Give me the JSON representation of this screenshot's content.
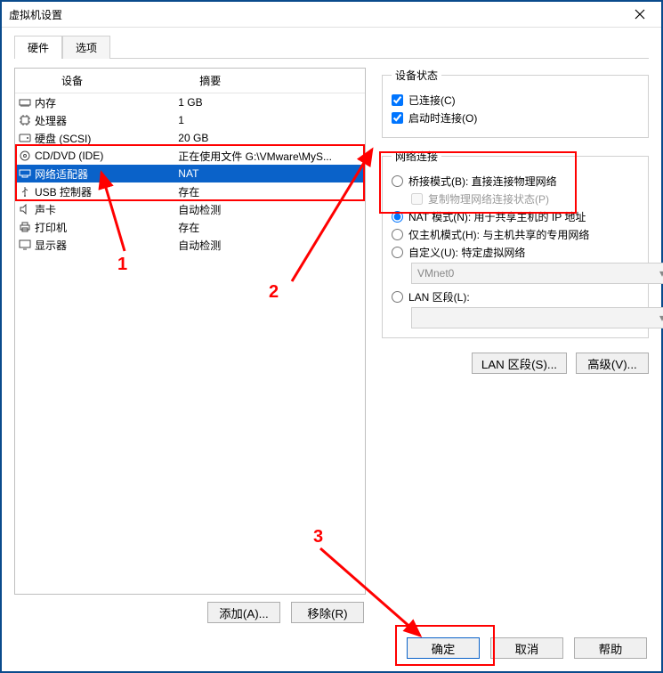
{
  "window": {
    "title": "虚拟机设置"
  },
  "tabs": {
    "hardware": "硬件",
    "options": "选项"
  },
  "deviceHeader": {
    "device": "设备",
    "summary": "摘要"
  },
  "devices": [
    {
      "name": "内存",
      "summary": "1 GB"
    },
    {
      "name": "处理器",
      "summary": "1"
    },
    {
      "name": "硬盘 (SCSI)",
      "summary": "20 GB"
    },
    {
      "name": "CD/DVD (IDE)",
      "summary": "正在使用文件 G:\\VMware\\MyS..."
    },
    {
      "name": "网络适配器",
      "summary": "NAT"
    },
    {
      "name": "USB 控制器",
      "summary": "存在"
    },
    {
      "name": "声卡",
      "summary": "自动检测"
    },
    {
      "name": "打印机",
      "summary": "存在"
    },
    {
      "name": "显示器",
      "summary": "自动检测"
    }
  ],
  "leftButtons": {
    "add": "添加(A)...",
    "remove": "移除(R)"
  },
  "status": {
    "legend": "设备状态",
    "connected": "已连接(C)",
    "connectOnPower": "启动时连接(O)"
  },
  "net": {
    "legend": "网络连接",
    "bridged": "桥接模式(B): 直接连接物理网络",
    "replicate": "复制物理网络连接状态(P)",
    "nat": "NAT 模式(N): 用于共享主机的 IP 地址",
    "hostonly": "仅主机模式(H): 与主机共享的专用网络",
    "custom": "自定义(U): 特定虚拟网络",
    "customValue": "VMnet0",
    "lan": "LAN 区段(L):",
    "lanValue": ""
  },
  "rightButtons": {
    "lanSeg": "LAN 区段(S)...",
    "advanced": "高级(V)..."
  },
  "footer": {
    "ok": "确定",
    "cancel": "取消",
    "help": "帮助"
  },
  "annotations": {
    "a1": "1",
    "a2": "2",
    "a3": "3"
  }
}
